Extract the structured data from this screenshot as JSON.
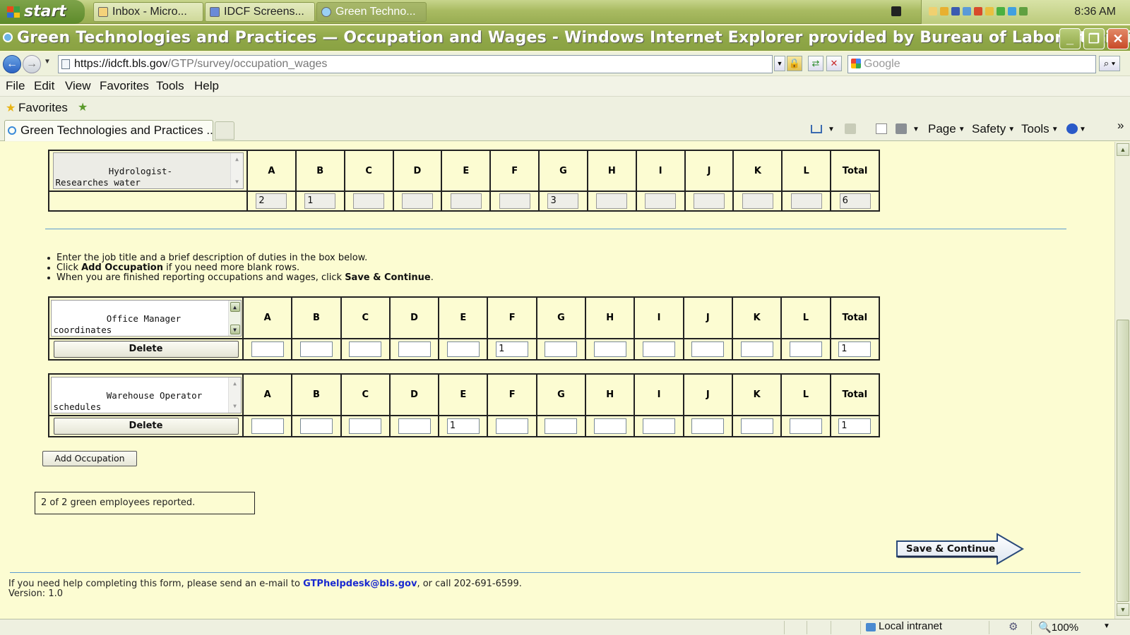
{
  "taskbar": {
    "start_label": "start",
    "tasks": [
      {
        "label": "Inbox - Micro..."
      },
      {
        "label": "IDCF Screens..."
      },
      {
        "label": "Green Techno..."
      }
    ],
    "clock": "8:36 AM"
  },
  "window": {
    "title": "Green Technologies and Practices — Occupation and Wages - Windows Internet Explorer provided by Bureau of Labor Statistics"
  },
  "address": {
    "url_host": "https://idcft.bls.gov",
    "url_path": "/GTP/survey/occupation_wages",
    "search_placeholder": "Google"
  },
  "menu": [
    "File",
    "Edit",
    "View",
    "Favorites",
    "Tools",
    "Help"
  ],
  "favorites_label": "Favorites",
  "tab": {
    "label": "Green Technologies and Practices ..."
  },
  "commands": {
    "page": "Page",
    "safety": "Safety",
    "tools": "Tools"
  },
  "columns": [
    "A",
    "B",
    "C",
    "D",
    "E",
    "F",
    "G",
    "H",
    "I",
    "J",
    "K",
    "L",
    "Total"
  ],
  "occupations": {
    "top": {
      "description": "Hydrologist- Researches water\nusage and implements\nwastewater treatment plans.",
      "values": [
        "2",
        "1",
        "",
        "",
        "",
        "",
        "3",
        "",
        "",
        "",
        "",
        "",
        "6"
      ]
    },
    "rows": [
      {
        "description": "Office Manager  coordinates\nthe recycling program for our\noffice and all of our",
        "delete_label": "Delete",
        "values": [
          "",
          "",
          "",
          "",
          "",
          "1",
          "",
          "",
          "",
          "",
          "",
          "",
          "1"
        ]
      },
      {
        "description": "Warehouse Operator schedules\npickup and delivery of waste\nto recycling center",
        "delete_label": "Delete",
        "values": [
          "",
          "",
          "",
          "",
          "1",
          "",
          "",
          "",
          "",
          "",
          "",
          "",
          "1"
        ]
      }
    ]
  },
  "instructions": {
    "line1": "Enter the job title and a brief description of duties in the box below.",
    "line2_pre": "Click ",
    "line2_bold": "Add Occupation",
    "line2_post": " if you need more blank rows.",
    "line3_pre": "When you are finished reporting occupations and wages, click ",
    "line3_bold": "Save & Continue",
    "line3_post": "."
  },
  "add_occupation_label": "Add Occupation",
  "employee_count_text": "2 of 2 green employees reported.",
  "save_continue_label": "Save & Continue",
  "help": {
    "pre": "If you need help completing this form, please send an e-mail to ",
    "email": "GTPhelpdesk@bls.gov",
    "post": ", or call 202-691-6599."
  },
  "version": "Version: 1.0",
  "status": {
    "zone": "Local intranet",
    "zoom": "100%"
  }
}
